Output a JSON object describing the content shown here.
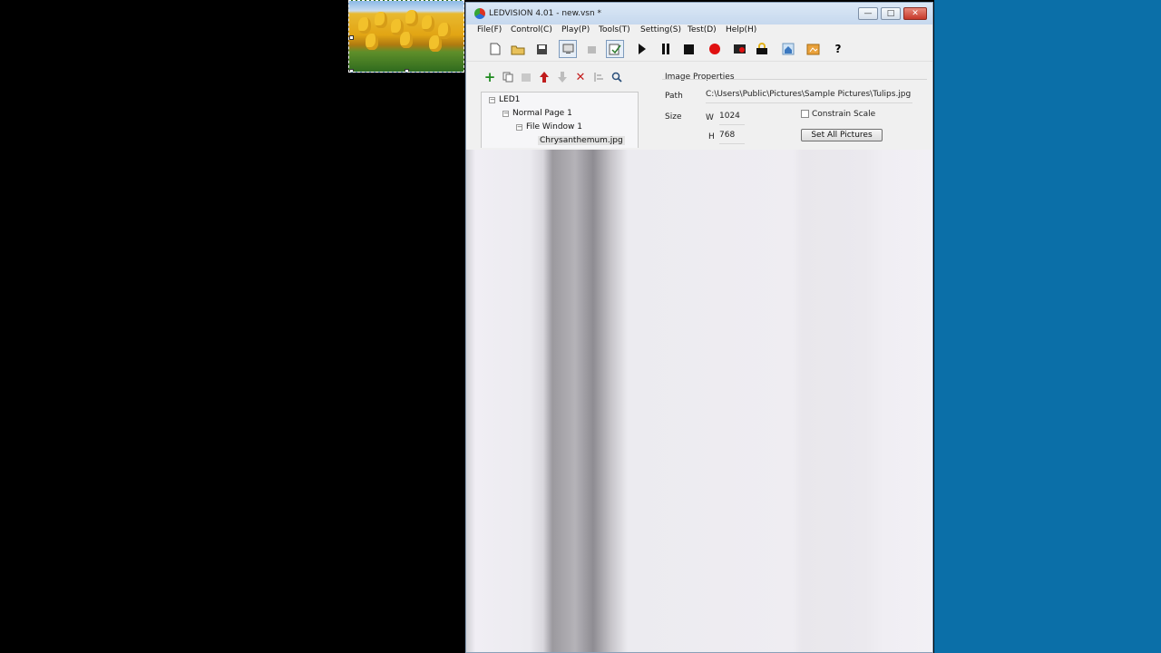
{
  "window": {
    "title": "LEDVISION 4.01 - new.vsn *",
    "minimize_glyph": "—",
    "maximize_glyph": "□",
    "close_glyph": "✕"
  },
  "menu": {
    "items": [
      "File(F)",
      "Control(C)",
      "Play(P)",
      "Tools(T)",
      "Setting(S)",
      "Test(D)",
      "Help(H)"
    ]
  },
  "toolbar": {
    "icons": [
      "new-file-icon",
      "open-folder-icon",
      "save-icon",
      "screen-icon",
      "grey-tool-icon",
      "edit-mode-icon",
      "play-icon",
      "pause-icon",
      "stop-icon",
      "record-icon",
      "screen-capture-icon",
      "lock-icon",
      "home-icon",
      "settings-folder-icon",
      "help-icon"
    ],
    "help_glyph": "?"
  },
  "tree_toolbar": {
    "icons": [
      "add-icon",
      "copy-icon",
      "paste-icon",
      "move-up-icon",
      "move-down-icon",
      "delete-icon",
      "sort-icon",
      "search-icon"
    ],
    "add_color": "#1e8a1e",
    "delete_color": "#c41d1d",
    "up_color": "#c01d1d"
  },
  "tree": {
    "root": "LED1",
    "page": "Normal Page 1",
    "window": "File Window 1",
    "file": "Chrysanthemum.jpg",
    "expander_glyph": "−"
  },
  "properties": {
    "title": "Image Properties",
    "path_label": "Path",
    "path_value": "C:\\Users\\Public\\Pictures\\Sample Pictures\\Tulips.jpg",
    "size_label": "Size",
    "w_label": "W",
    "w_value": "1024",
    "h_label": "H",
    "h_value": "768",
    "constrain_label": "Constrain Scale",
    "constrain_checked": false,
    "set_all_button": "Set All Pictures"
  },
  "colors": {
    "desktop_blue": "#0b6fa8",
    "record_red": "#e01010"
  }
}
